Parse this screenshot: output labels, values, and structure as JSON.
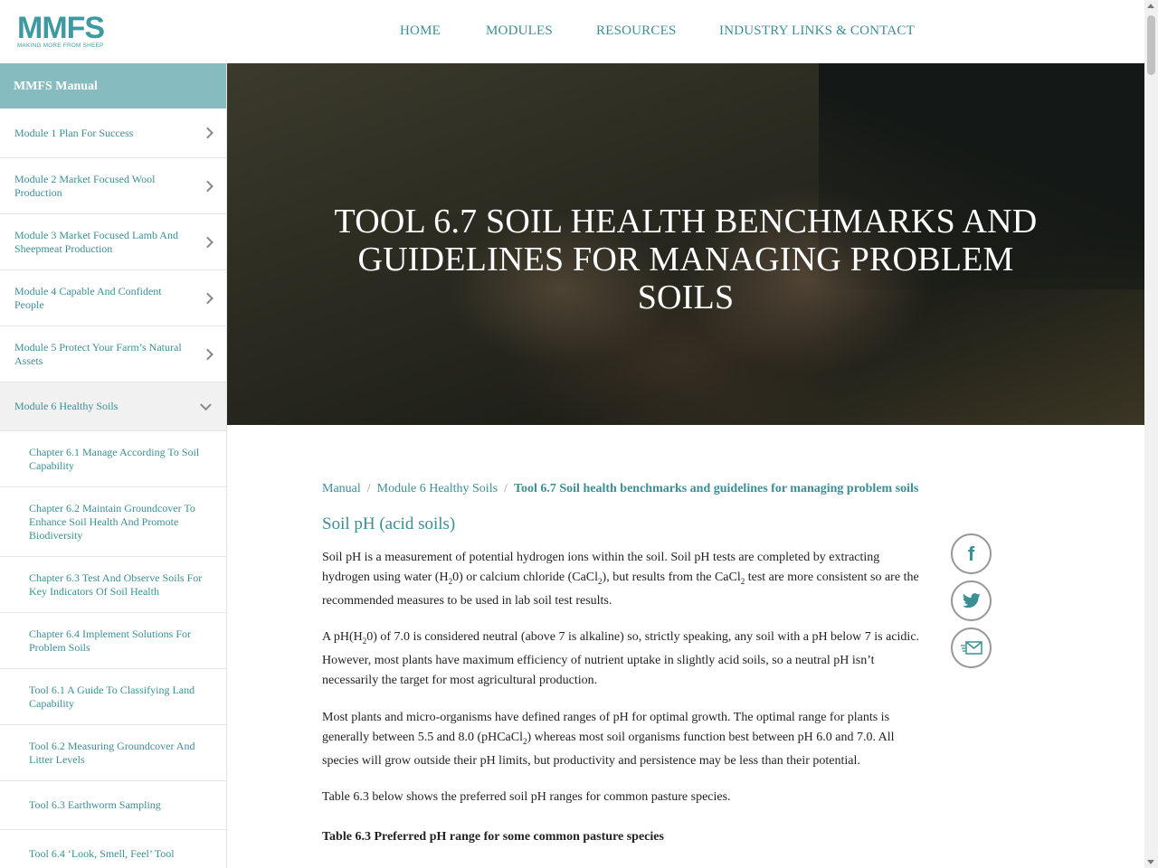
{
  "logo": {
    "letters": "MMFS",
    "tagline": "MAKING MORE FROM SHEEP"
  },
  "nav": [
    "HOME",
    "MODULES",
    "RESOURCES",
    "INDUSTRY LINKS & CONTACT"
  ],
  "sidebar": {
    "title": "MMFS Manual",
    "items": [
      {
        "label": "Module 1 Plan For Success"
      },
      {
        "label": "Module 2 Market Focused Wool Production"
      },
      {
        "label": "Module 3 Market Focused Lamb And Sheepmeat Production"
      },
      {
        "label": "Module 4 Capable And Confident People"
      },
      {
        "label": "Module 5 Protect Your Farm’s Natural Assets"
      },
      {
        "label": "Module 6 Healthy Soils"
      },
      {
        "label": "Chapter 6.1 Manage According To Soil Capability"
      },
      {
        "label": "Chapter 6.2 Maintain Groundcover To Enhance Soil Health And Promote Biodiversity"
      },
      {
        "label": "Chapter 6.3 Test And Observe Soils For Key Indicators Of Soil Health"
      },
      {
        "label": "Chapter 6.4 Implement Solutions For Problem Soils"
      },
      {
        "label": "Tool 6.1 A Guide To Classifying Land Capability"
      },
      {
        "label": "Tool 6.2 Measuring Groundcover And Litter Levels"
      },
      {
        "label": "Tool 6.3 Earthworm Sampling"
      },
      {
        "label": "Tool 6.4 ‘Look, Smell, Feel’ Tool"
      }
    ]
  },
  "hero": {
    "title": "TOOL 6.7 SOIL HEALTH BENCHMARKS AND GUIDELINES FOR MANAGING PROBLEM SOILS"
  },
  "breadcrumb": {
    "items": [
      "Manual",
      "Module 6 Healthy Soils"
    ],
    "current": "Tool 6.7 Soil health benchmarks and guidelines for managing problem soils",
    "separator": "/"
  },
  "section": {
    "heading": "Soil pH (acid soils)",
    "p1": {
      "a": "Soil pH is a measurement of potential hydrogen ions within the soil. Soil pH tests are completed by extracting hydrogen using water (H",
      "s1": "2",
      "b": "0) or calcium chloride (CaCl",
      "s2": "2",
      "c": "), but results from the CaCl",
      "s3": "2",
      "d": " test are more consistent so are the recommended measures to be used in lab soil test results."
    },
    "p2": {
      "a": "A pH(H",
      "s1": "2",
      "b": "0) of 7.0 is considered neutral (above 7 is alkaline) so, strictly speaking, any soil with a pH below 7 is acidic. However, most plants have maximum efficiency of nutrient uptake in slightly acid soils, so a neutral pH isn’t necessarily the target for most agricultural production."
    },
    "p3": {
      "a": "Most plants and micro-organisms have defined ranges of pH for optimal growth. The optimal range for plants is generally between 5.5 and 8.0 (pHCaCl",
      "s1": "2",
      "b": ") whereas most soil organisms function best between pH 6.0 and 7.0. All species will grow outside their pH limits, but productivity and persistence may be less than their potential."
    },
    "p4": "Table 6.3 below shows the preferred soil pH ranges for common pasture species.",
    "table_caption": "Table 6.3 Preferred pH range for some common pasture species"
  },
  "share": {
    "facebook": "f"
  },
  "colors": {
    "accent": "#3a8f95",
    "sidebar_header": "#86bcbf"
  }
}
